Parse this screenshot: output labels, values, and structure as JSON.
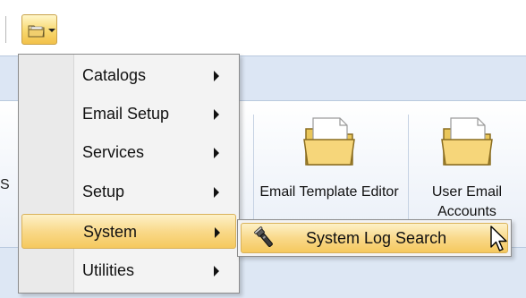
{
  "toolbar": {
    "app_button_icon": "folder-icon",
    "app_button_dropdown_icon": "chevron-down-icon"
  },
  "ribbon": {
    "left_partial_label": "S",
    "buttons": [
      {
        "label": "Email Template Editor",
        "icon": "folder-icon"
      },
      {
        "label": "User Email Accounts",
        "icon": "folder-icon"
      }
    ]
  },
  "menu": {
    "items": [
      {
        "label": "Catalogs",
        "has_submenu": true
      },
      {
        "label": "Email Setup",
        "has_submenu": true
      },
      {
        "label": "Services",
        "has_submenu": true
      },
      {
        "label": "Setup",
        "has_submenu": true
      },
      {
        "label": "System",
        "has_submenu": true,
        "active": true
      },
      {
        "label": "Utilities",
        "has_submenu": true
      }
    ]
  },
  "submenu": {
    "items": [
      {
        "label": "System Log Search",
        "icon": "flashlight-icon",
        "active": true
      }
    ]
  },
  "colors": {
    "highlight": "#f9d98a",
    "highlight_border": "#d9b25a",
    "ribbon": "#dce6f4",
    "menu_bg": "#f3f3f3"
  }
}
